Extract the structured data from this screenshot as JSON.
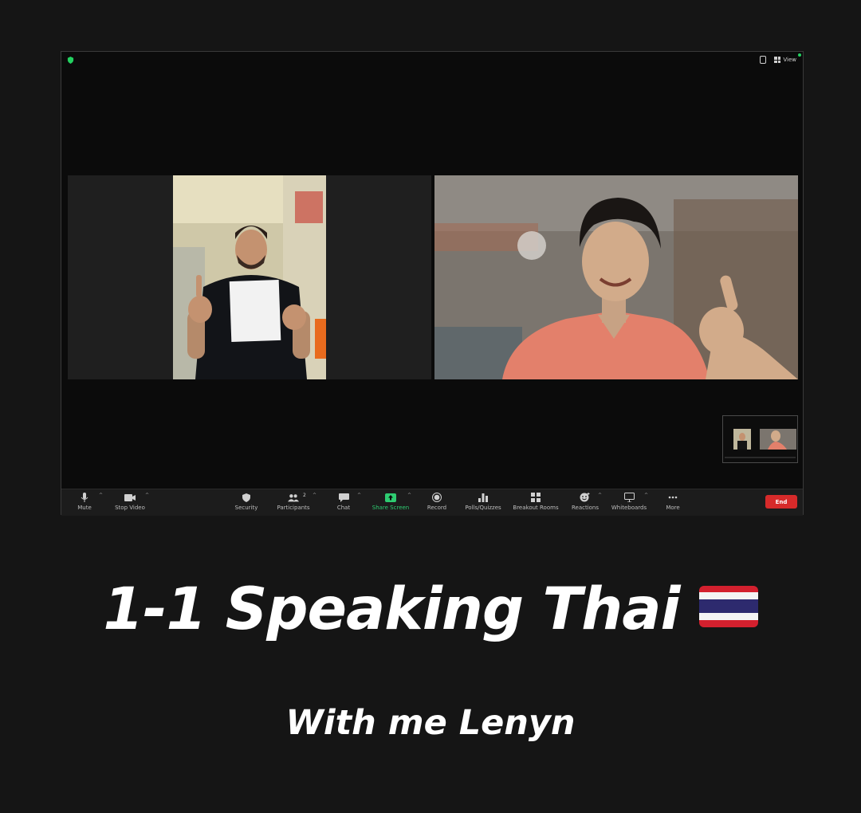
{
  "window": {
    "view_label": "View",
    "participants_count": "2"
  },
  "toolbar": {
    "mute_label": "Mute",
    "stop_video_label": "Stop Video",
    "security_label": "Security",
    "participants_label": "Participants",
    "chat_label": "Chat",
    "share_screen_label": "Share Screen",
    "record_label": "Record",
    "polls_label": "Polls/Quizzes",
    "breakout_label": "Breakout Rooms",
    "reactions_label": "Reactions",
    "whiteboards_label": "Whiteboards",
    "more_label": "More",
    "end_label": "End"
  },
  "caption": {
    "title": "1-1 Speaking Thai",
    "subtitle": "With me Lenyn"
  },
  "colors": {
    "share_green": "#2ecc71",
    "end_red": "#d62a2a",
    "flag_red": "#d3202e",
    "flag_blue": "#2d2a6e"
  },
  "icons": [
    "shield-icon",
    "mic-icon",
    "camera-icon",
    "security-icon",
    "participants-icon",
    "chat-icon",
    "share-screen-icon",
    "record-icon",
    "polls-icon",
    "breakout-icon",
    "reactions-icon",
    "whiteboard-icon",
    "more-icon",
    "thailand-flag-icon"
  ]
}
